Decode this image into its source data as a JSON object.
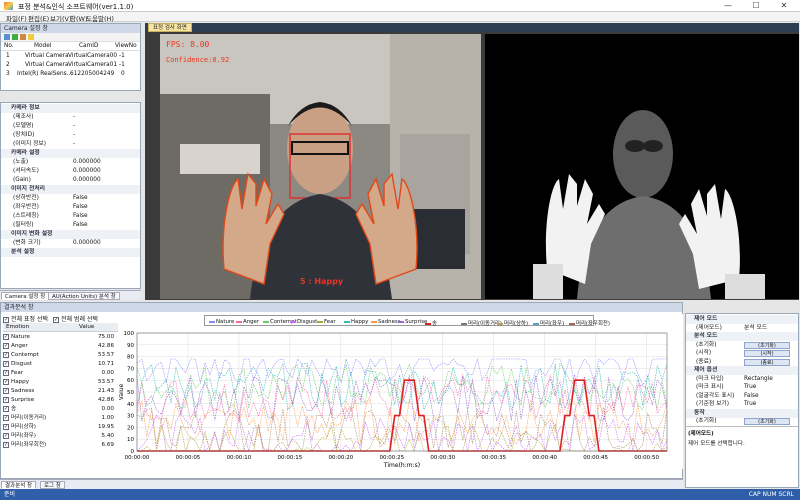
{
  "window": {
    "title": "표정 분석&인식 소프트웨어(ver1.1.0)",
    "min": "—",
    "max": "☐",
    "close": "✕"
  },
  "menu": [
    "파일(F)",
    "편집(E)",
    "보기(V)",
    "창(W)",
    "도움말(H)"
  ],
  "camera_panel": {
    "title": "Camera 설정 창",
    "headers": [
      "No.",
      "Model",
      "CamID",
      "ViewNo"
    ],
    "rows": [
      [
        "1",
        "Virtual Camera",
        "VirtualCamera00",
        "-1"
      ],
      [
        "2",
        "Virtual Camera",
        "VirtualCamera01",
        "-1"
      ],
      [
        "3",
        "Intel(R) RealSens...",
        "612205004249",
        "0"
      ]
    ]
  },
  "props": [
    {
      "cat": "카메라 정보",
      "items": [
        [
          "(제조사)",
          "-"
        ],
        [
          "(모델명)",
          "-"
        ],
        [
          "(장치ID)",
          "-"
        ],
        [
          "(이미지 정보)",
          "-"
        ]
      ]
    },
    {
      "cat": "카메라 설정",
      "items": [
        [
          "(노출)",
          "0.000000"
        ],
        [
          "(셔터속도)",
          "0.000000"
        ],
        [
          "(Gain)",
          "0.000000"
        ]
      ]
    },
    {
      "cat": "이미지 전처리",
      "items": [
        [
          "(상하반전)",
          "False"
        ],
        [
          "(좌우반전)",
          "False"
        ],
        [
          "(스트레칭)",
          "False"
        ],
        [
          "(필터링)",
          "False"
        ]
      ]
    },
    {
      "cat": "이미지 변화 설정",
      "items": [
        [
          "(변화 크기)",
          "0.000000"
        ]
      ]
    },
    {
      "cat": "분석 설정",
      "items": []
    }
  ],
  "left_tabs": [
    "Camera 설정 창",
    "AU(Action Units) 분석 창"
  ],
  "video": {
    "tab": "표정 검사 화면",
    "fps": "FPS: 8.00",
    "confidence": "Confidence:0.92",
    "emotion": "5 : Happy"
  },
  "bottom_panel": {
    "title": "결과분석 창",
    "check_all_expr": "전체 표정 선택",
    "check_all_graph": "전체 범례 선택",
    "col_name": "Emotion",
    "col_value": "Value",
    "emotions": [
      [
        "Nature",
        "75.00"
      ],
      [
        "Anger",
        "42.86"
      ],
      [
        "Contempt",
        "53.57"
      ],
      [
        "Disgust",
        "10.71"
      ],
      [
        "Fear",
        "0.00"
      ],
      [
        "Happy",
        "53.57"
      ],
      [
        "Sadness",
        "21.43"
      ],
      [
        "Surprise",
        "42.86"
      ],
      [
        "송",
        "0.00"
      ],
      [
        "머리(이동거리)",
        "1.00"
      ],
      [
        "머리(상하)",
        "19.95"
      ],
      [
        "머리(좌우)",
        "5.40"
      ],
      [
        "머리(좌우회전)",
        "6.69"
      ]
    ]
  },
  "legend": [
    "Nature",
    "Anger",
    "Contempt",
    "Disgust",
    "Fear",
    "Happy",
    "Sadness",
    "Surprise",
    "송",
    "머리(이동거리)",
    "머리(상하)",
    "머리(좌우)",
    "머리(좌우회전)"
  ],
  "chart_data": {
    "type": "line",
    "xlabel": "Time(h:m:s)",
    "ylabel": "Value",
    "ylim": [
      0,
      100
    ],
    "yticks": [
      0,
      10,
      20,
      30,
      40,
      50,
      60,
      70,
      80,
      90,
      100
    ],
    "xticks": [
      "00:00:00",
      "00:00:05",
      "00:00:10",
      "00:00:15",
      "00:00:20",
      "00:00:25",
      "00:00:30",
      "00:00:35",
      "00:00:40",
      "00:00:45",
      "00:00:50"
    ],
    "series": [
      {
        "name": "송",
        "color": "#e02020",
        "values": [
          0,
          0,
          0,
          0,
          0,
          0,
          0,
          0,
          0,
          0,
          0,
          0,
          0,
          0,
          0,
          0,
          0,
          0,
          0,
          0,
          0,
          0,
          0,
          0,
          0,
          0,
          0,
          0,
          0,
          0,
          0,
          0,
          0,
          0,
          0,
          0,
          0,
          0,
          0,
          0,
          0,
          0,
          0,
          0,
          0,
          0,
          0,
          0,
          0,
          0,
          0,
          0,
          0,
          30,
          30,
          60,
          60,
          60,
          30,
          30,
          0,
          0,
          0,
          0,
          0,
          0,
          0,
          0,
          0,
          0,
          0,
          0,
          0,
          0,
          0,
          0,
          0,
          0,
          0,
          0,
          0,
          0,
          0,
          0,
          0,
          0,
          0,
          0,
          30,
          30,
          60,
          60,
          60,
          30,
          30,
          0,
          0,
          0,
          0,
          0,
          0,
          0,
          0,
          0,
          0,
          0,
          0,
          0,
          0,
          0
        ]
      }
    ]
  },
  "control_panel": {
    "title": "제어 모드",
    "rows": [
      {
        "cat": "제어 모드"
      },
      {
        "k": "(제어모드)",
        "v": "분석 모드"
      },
      {
        "cat": "분석 모드"
      },
      {
        "k": "(초기화)",
        "v": "(초기화)",
        "btn": true
      },
      {
        "k": "(시작)",
        "v": "(시작)",
        "btn": true
      },
      {
        "k": "(종료)",
        "v": "(종료)",
        "btn": true
      },
      {
        "cat": "제어 옵션"
      },
      {
        "k": "(마크 타입)",
        "v": "Rectangle"
      },
      {
        "k": "(마크 표시)",
        "v": "True"
      },
      {
        "k": "(얼굴각도 표시)",
        "v": "False"
      },
      {
        "k": "(기준점 보기)",
        "v": "True"
      },
      {
        "cat": "동작"
      },
      {
        "k": "(초기화)",
        "v": "(초기화)",
        "btn": true
      }
    ],
    "desc_title": "(제어모드)",
    "desc_text": "제어 모드를 선택합니다."
  },
  "bottom_tabs": [
    "결과분석 창",
    "로그 창"
  ],
  "status": {
    "left": "준비",
    "right": "CAP NUM SCRL"
  }
}
